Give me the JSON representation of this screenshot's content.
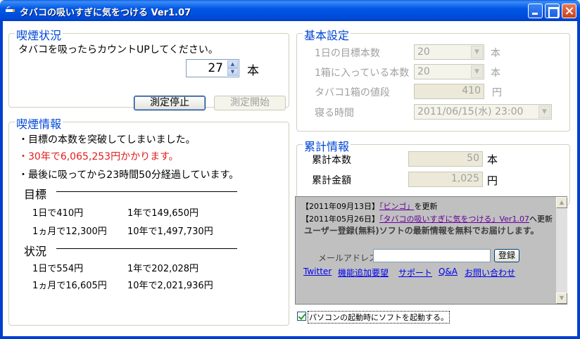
{
  "window": {
    "title": "タバコの吸いすぎに気をつける Ver1.07"
  },
  "smoking_status": {
    "legend": "喫煙状況",
    "instruction": "タバコを吸ったらカウントUPしてください。",
    "count": "27",
    "unit": "本",
    "stop_button": "測定停止",
    "start_button": "測定開始"
  },
  "smoking_info": {
    "legend": "喫煙情報",
    "line1": "・目標の本数を突破してしまいました。",
    "line2": "・30年で6,065,253円かかります。",
    "line3": "・最後に吸ってから23時間50分経過しています。",
    "target": {
      "heading": "目標",
      "day": "1日で410円",
      "year": "1年で149,650円",
      "month": "1ヵ月で12,300円",
      "decade": "10年で1,497,730円"
    },
    "actual": {
      "heading": "状況",
      "day": "1日で554円",
      "year": "1年で202,028円",
      "month": "1ヵ月で16,605円",
      "decade": "10年で2,021,936円"
    }
  },
  "basic_settings": {
    "legend": "基本設定",
    "daily_target_label": "1日の目標本数",
    "daily_target_value": "20",
    "per_pack_label": "1箱に入っている本数",
    "per_pack_value": "20",
    "unit_hon": "本",
    "price_label": "タバコ1箱の値段",
    "price_value": "410",
    "unit_yen": "円",
    "bedtime_label": "寝る時間",
    "bedtime_value": "2011/06/15(水) 23:00"
  },
  "cumulative": {
    "legend": "累計情報",
    "count_label": "累計本数",
    "count_value": "50",
    "count_unit": "本",
    "amount_label": "累計金額",
    "amount_value": "1,025",
    "amount_unit": "円"
  },
  "news": {
    "item1_date": "【2011年09月13日】",
    "item1_link": "「ビンゴ」",
    "item1_suffix": "を更新",
    "item2_date": "【2011年05月26日】",
    "item2_link": "「タバコの吸いすぎに気をつける」Ver1.07",
    "item2_suffix": "へ更新",
    "register_text": "ユーザー登録(無料)ソフトの最新情報を無料でお届けします。",
    "email_label": "メールアドレス:",
    "email_value": "",
    "register_button": "登録",
    "links": [
      "Twitter",
      "機能追加要望",
      "サポート",
      "Q&A",
      "お問い合わせ"
    ]
  },
  "startup": {
    "label": "パソコンの起動時にソフトを起動する。",
    "checked": true
  }
}
